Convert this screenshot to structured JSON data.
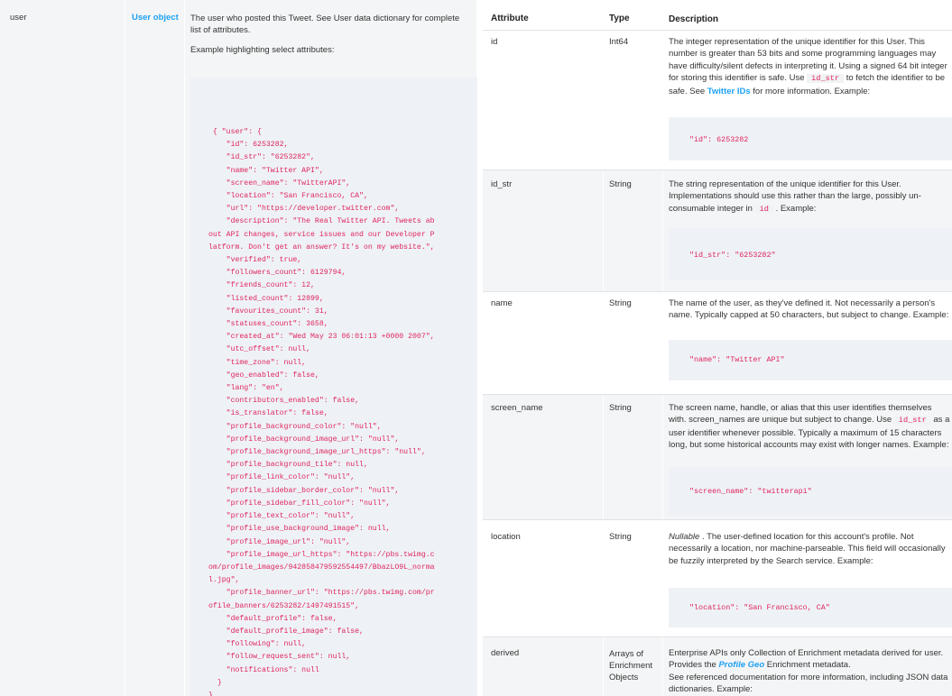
{
  "left_table": {
    "field": "user",
    "type_link": "User object",
    "description": "The user who posted this Tweet. See User data dictionary for complete list of attributes.",
    "example_caption": "Example highlighting select attributes:",
    "code": " { \"user\": {\n    \"id\": 6253282,\n    \"id_str\": \"6253282\",\n    \"name\": \"Twitter API\",\n    \"screen_name\": \"TwitterAPI\",\n    \"location\": \"San Francisco, CA\",\n    \"url\": \"https://developer.twitter.com\",\n    \"description\": \"The Real Twitter API. Tweets ab\nout API changes, service issues and our Developer P\nlatform. Don't get an answer? It's on my website.\",\n    \"verified\": true,\n    \"followers_count\": 6129794,\n    \"friends_count\": 12,\n    \"listed_count\": 12899,\n    \"favourites_count\": 31,\n    \"statuses_count\": 3658,\n    \"created_at\": \"Wed May 23 06:01:13 +0000 2007\",\n    \"utc_offset\": null,\n    \"time_zone\": null,\n    \"geo_enabled\": false,\n    \"lang\": \"en\",\n    \"contributors_enabled\": false,\n    \"is_translator\": false,\n    \"profile_background_color\": \"null\",\n    \"profile_background_image_url\": \"null\",\n    \"profile_background_image_url_https\": \"null\",\n    \"profile_background_tile\": null,\n    \"profile_link_color\": \"null\",\n    \"profile_sidebar_border_color\": \"null\",\n    \"profile_sidebar_fill_color\": \"null\",\n    \"profile_text_color\": \"null\",\n    \"profile_use_background_image\": null,\n    \"profile_image_url\": \"null\",\n    \"profile_image_url_https\": \"https://pbs.twimg.c\nom/profile_images/942858479592554497/BbazLO9L_norma\nl.jpg\",\n    \"profile_banner_url\": \"https://pbs.twimg.com/pr\nofile_banners/6253282/1497491515\",\n    \"default_profile\": false,\n    \"default_profile_image\": false,\n    \"following\": null,\n    \"follow_request_sent\": null,\n    \"notifications\": null\n  }\n}"
  },
  "right_table": {
    "headers": {
      "attribute": "Attribute",
      "type": "Type",
      "description": "Description"
    },
    "id": {
      "name": "id",
      "type": "Int64",
      "d1": "The integer representation of the unique identifier for this User. This number is greater than 53 bits and some programming languages may have difficulty/silent defects in interpreting it. Using a signed 64 bit integer for storing this identifier is safe. Use",
      "code1": "id_str",
      "d2": "to fetch the identifier to be safe. See",
      "link": "Twitter IDs",
      "d3": "for more information. Example:",
      "example": "\"id\": 6253282"
    },
    "id_str": {
      "name": "id_str",
      "type": "String",
      "d1": "The string representation of the unique identifier for this User. Implementations should use this rather than the large, possibly un-consumable integer in",
      "code1": "id",
      "d2": ". Example:",
      "example": "\"id_str\": \"6253282\""
    },
    "name": {
      "name": "name",
      "type": "String",
      "d1": "The name of the user, as they've defined it. Not necessarily a person's name. Typically capped at 50 characters, but subject to change. Example:",
      "example": "\"name\": \"Twitter API\""
    },
    "screen_name": {
      "name": "screen_name",
      "type": "String",
      "d1": "The screen name, handle, or alias that this user identifies themselves with. screen_names are unique but subject to change. Use",
      "code1": "id_str",
      "d2": "as a user identifier whenever possible. Typically a maximum of 15 characters long, but some historical accounts may exist with longer names. Example:",
      "example": "\"screen_name\": \"twitterapi\""
    },
    "location": {
      "name": "location",
      "type": "String",
      "nullable": "Nullable",
      "d1": ". The user-defined location for this account's profile. Not necessarily a location, nor machine-parseable. This field will occasionally be fuzzily interpreted by the Search service. Example:",
      "example": "\"location\": \"San Francisco, CA\""
    },
    "derived": {
      "name": "derived",
      "type": "Arrays of Enrichment Objects",
      "d1": "Enterprise APIs only Collection of Enrichment metadata derived for user. Provides the",
      "link": "Profile Geo",
      "d2": "Enrichment metadata.",
      "d3": "See referenced documentation for more information, including JSON data dictionaries. Example:"
    }
  }
}
